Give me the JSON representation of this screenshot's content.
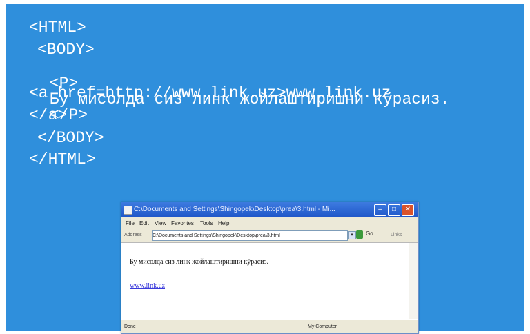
{
  "code": {
    "line1": "<HTML>",
    "line2": "<BODY>",
    "line3_open": "<P>",
    "line3_text": "Бу мисолда сиз линк жойлаштиришни кўрасиз.",
    "line3_close": "</P>",
    "line4": "<a href=http://www.link.uz>www.link.uz",
    "line5": "</a>",
    "line6": "</BODY>",
    "line7": "</HTML>"
  },
  "browser": {
    "title": "C:\\Documents and Settings\\Shingopek\\Desktop\\prea\\3.html - Mi...",
    "menu": [
      "File",
      "Edit",
      "View",
      "Favorites",
      "Tools",
      "Help"
    ],
    "address_label": "Address",
    "address": "C:\\Documents and Settings\\Shingopek\\Desktop\\prea\\3.html",
    "go": "Go",
    "links": "Links",
    "content_text": "Бу мисолда сиз линк жойлаштиришни кўрасиз.",
    "link_text": "www.link.uz",
    "status_done": "Done",
    "status_zone": "My Computer"
  },
  "colors": {
    "panel": "#2f8fdc",
    "code_text": "#ffffff",
    "link": "#3a3adb"
  }
}
